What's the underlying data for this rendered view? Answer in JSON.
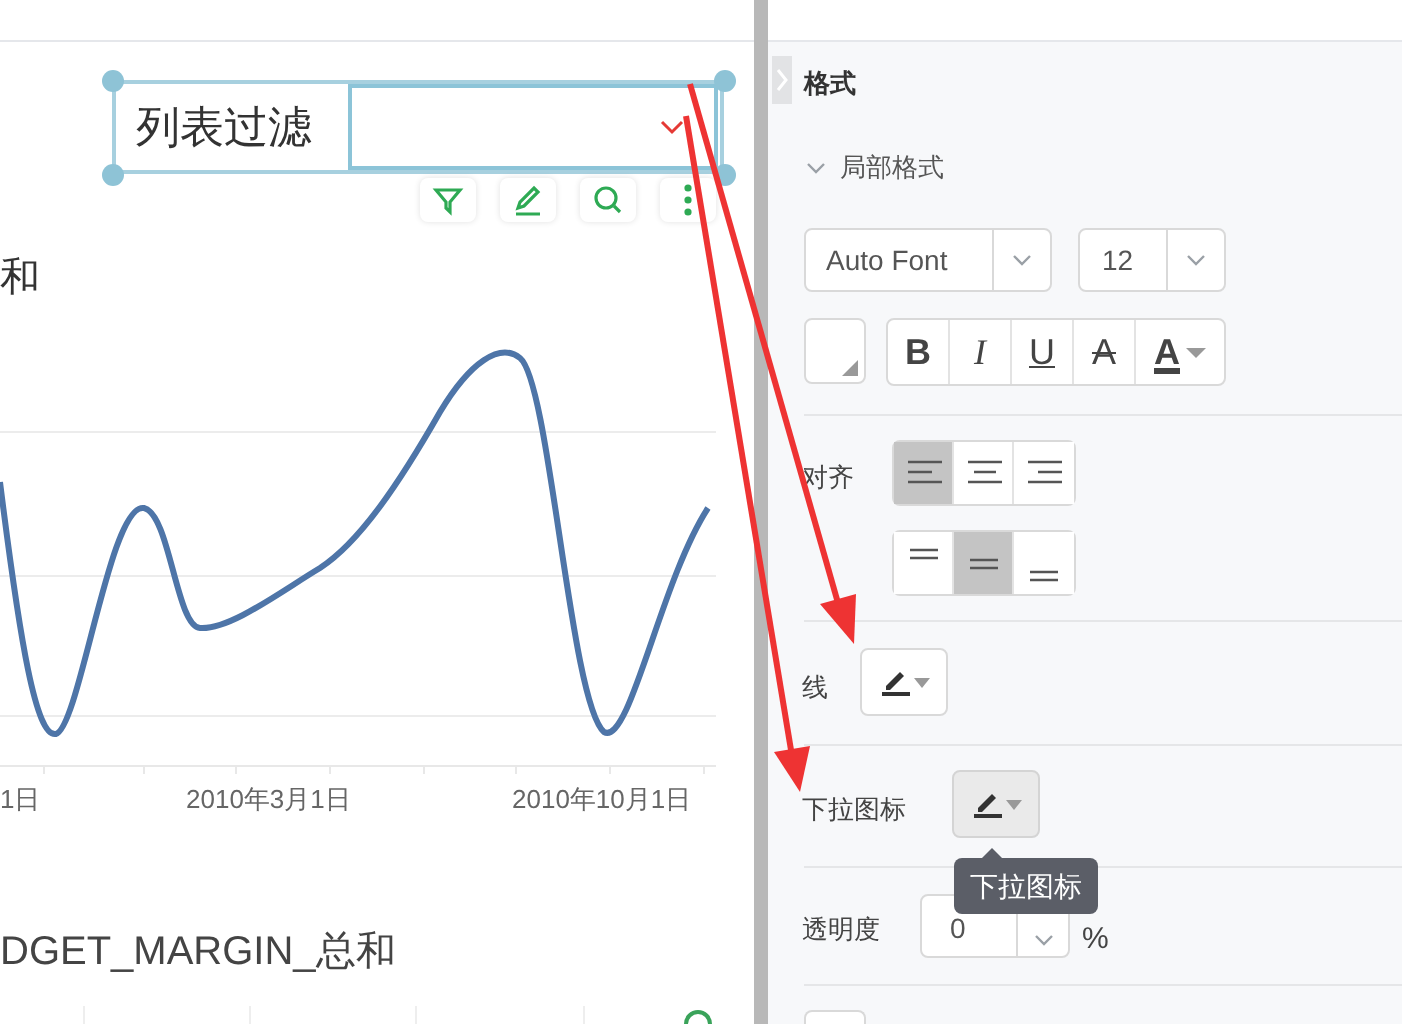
{
  "filter_widget": {
    "label": "列表过滤"
  },
  "chart": {
    "title": "和",
    "x_labels": [
      "1日",
      "2010年3月1日",
      "2010年10月1日"
    ]
  },
  "chart_2": {
    "title": "DGET_MARGIN_总和"
  },
  "panel": {
    "title": "格式",
    "section": {
      "title": "局部格式",
      "expanded": true
    },
    "font": "Auto Font",
    "size": "12",
    "styles": [
      {
        "kind": "bold",
        "label": "B"
      },
      {
        "kind": "italic",
        "label": "I"
      },
      {
        "kind": "underline",
        "label": "U"
      },
      {
        "kind": "strike",
        "label": "A"
      },
      {
        "kind": "color",
        "label": "A"
      }
    ],
    "align_label": "对齐",
    "align_h": [
      {
        "kind": "left",
        "selected": true
      },
      {
        "kind": "center",
        "selected": false
      },
      {
        "kind": "right",
        "selected": false
      }
    ],
    "align_v": [
      {
        "kind": "top",
        "selected": false
      },
      {
        "kind": "middle",
        "selected": true
      },
      {
        "kind": "bottom",
        "selected": false
      }
    ],
    "line_label": "线",
    "dropdown_icon_label": "下拉图标",
    "tooltip": "下拉图标",
    "opacity": {
      "label": "透明度",
      "value": "0",
      "unit": "%"
    }
  }
}
